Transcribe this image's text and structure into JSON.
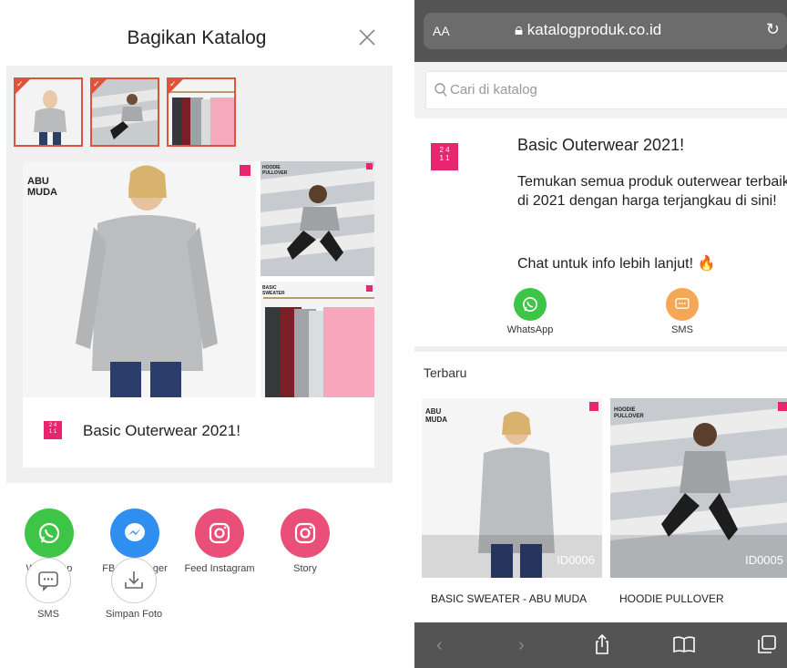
{
  "left": {
    "title": "Bagikan Katalog",
    "card_title": "Basic Outerwear 2021!",
    "card_labels": {
      "main": "ABU\nMUDA",
      "hoodie": "HOODIE\nPULLOVER",
      "sweater": "BASIC\nSWEATER"
    },
    "logo_text": "2 4\n1 1",
    "share": [
      {
        "label": "WhatsApp",
        "icon": "whatsapp-icon",
        "color": "#3ec447"
      },
      {
        "label": "FB Messenger",
        "icon": "messenger-icon",
        "color": "#2f8ff0"
      },
      {
        "label": "Feed Instagram",
        "icon": "instagram-icon",
        "color": "#ea4f7a"
      },
      {
        "label": "Story",
        "icon": "instagram-icon",
        "color": "#ea4f7a"
      },
      {
        "label": "SMS",
        "icon": "sms-icon",
        "color": "#ffffff"
      },
      {
        "label": "Simpan Foto",
        "icon": "download-icon",
        "color": "#ffffff"
      }
    ]
  },
  "right": {
    "url": "katalogproduk.co.id",
    "aa": "AA",
    "search_placeholder": "Cari di katalog",
    "title": "Basic Outerwear 2021!",
    "description": "Temukan semua produk outerwear terbaik di 2021 dengan harga terjangkau di sini!",
    "chat": "Chat untuk info lebih lanjut! 🔥",
    "contacts": [
      {
        "label": "WhatsApp",
        "color": "#3ec447",
        "icon": "whatsapp-icon"
      },
      {
        "label": "SMS",
        "color": "#f4a857",
        "icon": "sms-icon"
      }
    ],
    "section": "Terbaru",
    "products": [
      {
        "id": "ID0006",
        "name": "BASIC SWEATER - ABU MUDA",
        "tag": "ABU\nMUDA"
      },
      {
        "id": "ID0005",
        "name": "HOODIE PULLOVER",
        "tag": "HOODIE\nPULLOVER"
      }
    ]
  },
  "colors": {
    "accent": "#e0533b",
    "brand": "#e8256f"
  }
}
